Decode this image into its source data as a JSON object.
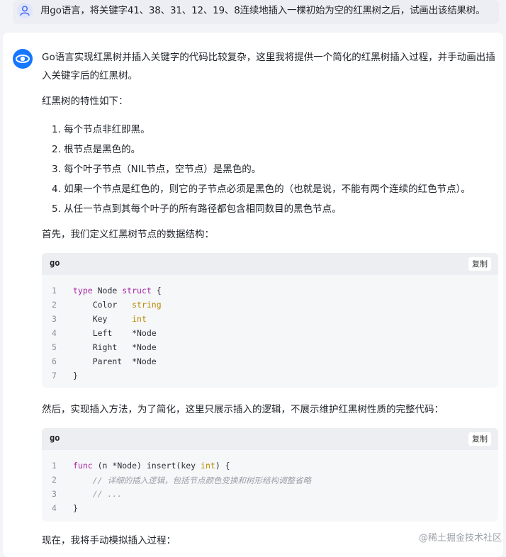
{
  "user": {
    "question": "用go语言，将关键字41、38、31、12、19、8连续地插入一棵初始为空的红黑树之后，试画出该结果树。"
  },
  "answer": {
    "intro": "Go语言实现红黑树并插入关键字的代码比较复杂，这里我将提供一个简化的红黑树插入过程，并手动画出插入关键字后的红黑树。",
    "props_title": "红黑树的特性如下：",
    "props": [
      "1. 每个节点非红即黑。",
      "2. 根节点是黑色的。",
      "3. 每个叶子节点（NIL节点，空节点）是黑色的。",
      "4. 如果一个节点是红色的，则它的子节点必须是黑色的（也就是说，不能有两个连续的红色节点）。",
      "5. 从任一节点到其每个叶子的所有路径都包含相同数目的黑色节点。"
    ],
    "struct_intro": "首先，我们定义红黑树节点的数据结构：",
    "insert_intro": "然后，实现插入方法，为了简化，这里只展示插入的逻辑，不展示维护红黑树性质的完整代码：",
    "outro": "现在，我将手动模拟插入过程："
  },
  "code1": {
    "lang": "go",
    "copy_label": "复制",
    "line_numbers": [
      "1",
      "2",
      "3",
      "4",
      "5",
      "6",
      "7"
    ],
    "l1_kw": "type",
    "l1_name": " Node ",
    "l1_kw2": "struct",
    "l1_brace": " {",
    "l2_field": "    Color   ",
    "l2_type": "string",
    "l3_field": "    Key     ",
    "l3_type": "int",
    "l4": "    Left    *Node",
    "l5": "    Right   *Node",
    "l6": "    Parent  *Node",
    "l7": "}"
  },
  "code2": {
    "lang": "go",
    "copy_label": "复制",
    "line_numbers": [
      "1",
      "2",
      "3",
      "4"
    ],
    "l1_kw": "func",
    "l1_a": " (n *Node) insert(key ",
    "l1_type": "int",
    "l1_b": ") {",
    "l2": "    // 详细的插入逻辑，包括节点颜色变换和树形结构调整省略",
    "l3": "    // ...",
    "l4": "}"
  },
  "watermark": "@稀土掘金技术社区"
}
